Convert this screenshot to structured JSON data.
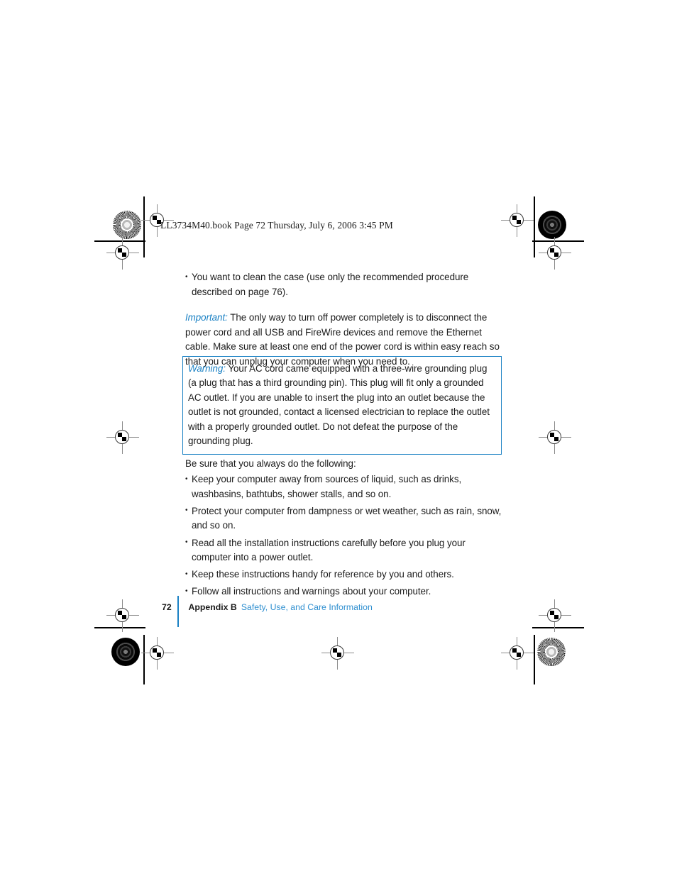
{
  "header": {
    "file_line": "LL3734M40.book  Page 72  Thursday, July 6, 2006  3:45 PM"
  },
  "content": {
    "top_bullets": [
      "You want to clean the case (use only the recommended procedure described on page 76)."
    ],
    "important": {
      "label": "Important:",
      "text": " The only way to turn off power completely is to disconnect the power cord and all USB and FireWire devices and remove the Ethernet cable. Make sure at least one end of the power cord is within easy reach so that you can unplug your computer when you need to."
    },
    "warning": {
      "label": "Warning:",
      "text": " Your AC cord came equipped with a three-wire grounding plug (a plug that has a third grounding pin). This plug will fit only a grounded AC outlet. If you are unable to insert the plug into an outlet because the outlet is not grounded, contact a licensed electrician to replace the outlet with a properly grounded outlet. Do not defeat the purpose of the grounding plug."
    },
    "lead_in": "Be sure that you always do the following:",
    "bullets": [
      "Keep your computer away from sources of liquid, such as drinks, washbasins, bathtubs, shower stalls, and so on.",
      "Protect your computer from dampness or wet weather, such as rain, snow, and so on.",
      "Read all the installation instructions carefully before you plug your computer into a power outlet.",
      "Keep these instructions handy for reference by you and others.",
      "Follow all instructions and warnings about your computer."
    ]
  },
  "footer": {
    "page_number": "72",
    "appendix": "Appendix B",
    "chapter_title": "Safety, Use, and Care Information"
  },
  "colors": {
    "accent_blue": "#1a81c4",
    "footer_blue": "#2f8fd0",
    "text": "#1b1b1b"
  }
}
